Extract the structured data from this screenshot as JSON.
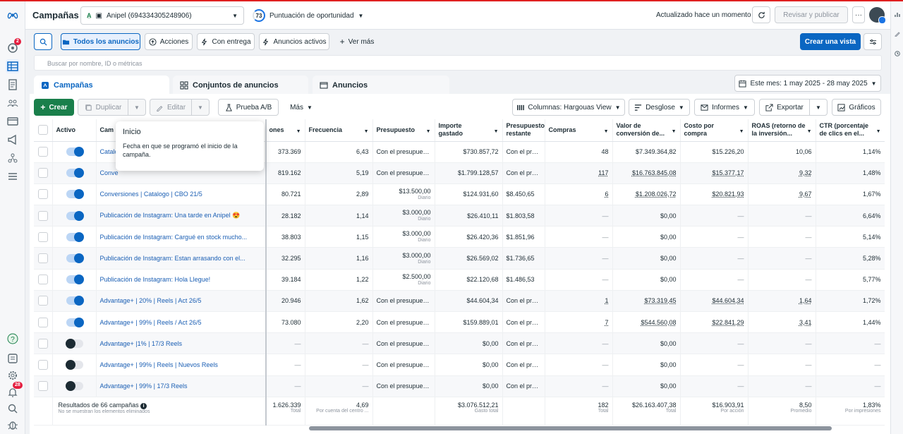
{
  "header": {
    "title": "Campañas",
    "account_name": "Anipel (694334305248906)",
    "opportunity_score": "73",
    "opportunity_label": "Puntuación de oportunidad",
    "updated": "Actualizado hace un momento",
    "review_publish": "Revisar y publicar",
    "more": "···"
  },
  "leftnav": {
    "notifications_badge": "2",
    "alerts_badge": "28"
  },
  "toolbar": {
    "all_ads": "Todos los anuncios",
    "actions": "Acciones",
    "with_delivery": "Con entrega",
    "active_ads": "Anuncios activos",
    "see_more": "Ver más",
    "create_view": "Crear una vista"
  },
  "search": {
    "placeholder": "Buscar por nombre, ID o métricas"
  },
  "tabs": {
    "campaigns": "Campañas",
    "adsets": "Conjuntos de anuncios",
    "ads": "Anuncios"
  },
  "date_range": "Este mes: 1 may 2025 - 28 may 2025",
  "actions": {
    "create": "Crear",
    "duplicate": "Duplicar",
    "edit": "Editar",
    "ab_test": "Prueba A/B",
    "more": "Más",
    "columns": "Columnas: Hargouas View",
    "breakdown": "Desglose",
    "reports": "Informes",
    "export": "Exportar",
    "charts": "Gráficos"
  },
  "colors": {
    "accent": "#0a66c2",
    "create": "#1a7f4b",
    "link": "#1b5fb4"
  },
  "table": {
    "headers": {
      "active": "Activo",
      "campaign": "Cam",
      "impressions": "ones",
      "frequency": "Frecuencia",
      "budget": "Presupuesto",
      "spent": "Importe gastado",
      "remaining": "Presupuesto restante",
      "purchases": "Compras",
      "conv_value": "Valor de conversión de...",
      "cpp": "Costo por compra",
      "roas": "ROAS (retorno de la inversión...",
      "ctr": "CTR (porcentaje de clics en el..."
    },
    "rows": [
      {
        "on": true,
        "name": "Catalo",
        "impr": "373.369",
        "freq": "6,43",
        "budget": "Con el presupues...",
        "budget_sub": "",
        "spent": "$730.857,72",
        "remaining": "Con el pre...",
        "purch": "48",
        "value": "$7.349.364,82",
        "cpp": "$15.226,20",
        "roas": "10,06",
        "ctr": "1,14%"
      },
      {
        "on": true,
        "name": "Conve",
        "impr": "819.162",
        "freq": "5,19",
        "budget": "Con el presupues...",
        "budget_sub": "",
        "spent": "$1.799.128,57",
        "remaining": "Con el pre...",
        "purch": "117",
        "value": "$16.763.845,08",
        "cpp": "$15.377,17",
        "roas": "9,32",
        "ctr": "1,48%"
      },
      {
        "on": true,
        "name": "Conversiones | Catalogo | CBO 21/5",
        "impr": "80.721",
        "freq": "2,89",
        "budget": "$13.500,00",
        "budget_sub": "Diario",
        "spent": "$124.931,60",
        "remaining": "$8.450,65",
        "purch": "6",
        "value": "$1.208.026,72",
        "cpp": "$20.821,93",
        "roas": "9,67",
        "ctr": "1,67%"
      },
      {
        "on": true,
        "name": "Publicación de Instagram: Una tarde en Anipel 😍",
        "impr": "28.182",
        "freq": "1,14",
        "budget": "$3.000,00",
        "budget_sub": "Diario",
        "spent": "$26.410,11",
        "remaining": "$1.803,58",
        "purch": "—",
        "value": "$0,00",
        "cpp": "—",
        "roas": "—",
        "ctr": "6,64%"
      },
      {
        "on": true,
        "name": "Publicación de Instagram: Cargué en stock mucho...",
        "impr": "38.803",
        "freq": "1,15",
        "budget": "$3.000,00",
        "budget_sub": "Diario",
        "spent": "$26.420,36",
        "remaining": "$1.851,96",
        "purch": "—",
        "value": "$0,00",
        "cpp": "—",
        "roas": "—",
        "ctr": "5,14%"
      },
      {
        "on": true,
        "name": "Publicación de Instagram: Estan arrasando con el...",
        "impr": "32.295",
        "freq": "1,16",
        "budget": "$3.000,00",
        "budget_sub": "Diario",
        "spent": "$26.569,02",
        "remaining": "$1.736,65",
        "purch": "—",
        "value": "$0,00",
        "cpp": "—",
        "roas": "—",
        "ctr": "5,28%"
      },
      {
        "on": true,
        "name": "Publicación de Instagram: Hola Llegue!",
        "impr": "39.184",
        "freq": "1,22",
        "budget": "$2.500,00",
        "budget_sub": "Diario",
        "spent": "$22.120,68",
        "remaining": "$1.486,53",
        "purch": "—",
        "value": "$0,00",
        "cpp": "—",
        "roas": "—",
        "ctr": "5,77%"
      },
      {
        "on": true,
        "name": "Advantage+ | 20% | Reels | Act 26/5",
        "impr": "20.946",
        "freq": "1,62",
        "budget": "Con el presupues...",
        "budget_sub": "",
        "spent": "$44.604,34",
        "remaining": "Con el pre...",
        "purch": "1",
        "value": "$73.319,45",
        "cpp": "$44.604,34",
        "roas": "1,64",
        "ctr": "1,72%"
      },
      {
        "on": true,
        "name": "Advantage+ | 99% | Reels / Act 26/5",
        "impr": "73.080",
        "freq": "2,20",
        "budget": "Con el presupues...",
        "budget_sub": "",
        "spent": "$159.889,01",
        "remaining": "Con el pre...",
        "purch": "7",
        "value": "$544.560,08",
        "cpp": "$22.841,29",
        "roas": "3,41",
        "ctr": "1,44%"
      },
      {
        "on": false,
        "name": "Advantage+ |1% | 17/3 Reels",
        "impr": "—",
        "freq": "—",
        "budget": "Con el presupues...",
        "budget_sub": "",
        "spent": "$0,00",
        "remaining": "Con el pre...",
        "purch": "—",
        "value": "$0,00",
        "cpp": "—",
        "roas": "—",
        "ctr": "—"
      },
      {
        "on": false,
        "name": "Advantage+ | 99% | Reels | Nuevos Reels",
        "impr": "—",
        "freq": "—",
        "budget": "Con el presupues...",
        "budget_sub": "",
        "spent": "$0,00",
        "remaining": "Con el pre...",
        "purch": "—",
        "value": "$0,00",
        "cpp": "—",
        "roas": "—",
        "ctr": "—"
      },
      {
        "on": false,
        "name": "Advantage+ | 99% | 17/3 Reels",
        "impr": "—",
        "freq": "—",
        "budget": "Con el presupues...",
        "budget_sub": "",
        "spent": "$0,00",
        "remaining": "Con el pre...",
        "purch": "—",
        "value": "$0,00",
        "cpp": "—",
        "roas": "—",
        "ctr": "—"
      }
    ],
    "footer": {
      "results": "Resultados de 66 campañas",
      "results_sub": "No se muestran los elementos eliminados",
      "impr": "1.626.339",
      "impr_sub": "Total",
      "freq": "4,69",
      "freq_sub": "Por cuenta del centro ...",
      "spent": "$3.076.512,21",
      "spent_sub": "Gasto total",
      "purch": "182",
      "purch_sub": "Total",
      "value": "$26.163.407,38",
      "value_sub": "Total",
      "cpp": "$16.903,91",
      "cpp_sub": "Por acción",
      "roas": "8,50",
      "roas_sub": "Promedio",
      "ctr": "1,83%",
      "ctr_sub": "Por impresiones"
    }
  },
  "tooltip": {
    "title": "Inicio",
    "text": "Fecha en que se programó el inicio de la campaña."
  }
}
